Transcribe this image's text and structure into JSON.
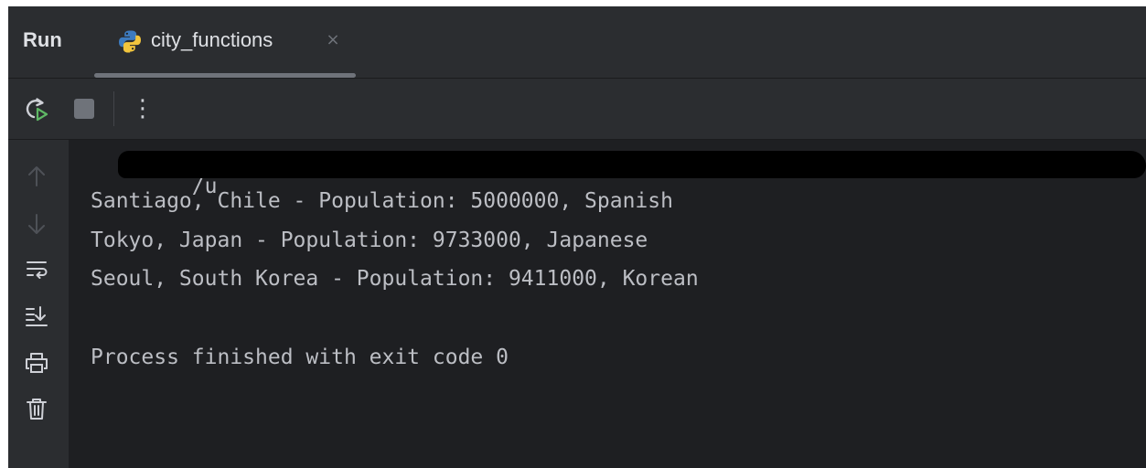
{
  "tabbar": {
    "run_label": "Run",
    "tab_label": "city_functions",
    "close_glyph": "×"
  },
  "toolbar": {
    "more_glyph": "⋮"
  },
  "console": {
    "path_prefix": "/u",
    "lines": [
      "Santiago, Chile - Population: 5000000, Spanish",
      "Tokyo, Japan - Population: 9733000, Japanese",
      "Seoul, South Korea - Population: 9411000, Korean"
    ],
    "exit_message": "Process finished with exit code 0"
  },
  "icons": {
    "python": "python-icon",
    "rerun": "rerun-icon",
    "stop": "stop-icon",
    "up": "arrow-up-icon",
    "down": "arrow-down-icon",
    "wrap": "soft-wrap-icon",
    "scroll_end": "scroll-to-end-icon",
    "print": "print-icon",
    "trash": "trash-icon"
  },
  "colors": {
    "background": "#1e1f22",
    "chrome": "#2b2d30",
    "text": "#bcbec4",
    "rerun_green": "#5fb865"
  }
}
